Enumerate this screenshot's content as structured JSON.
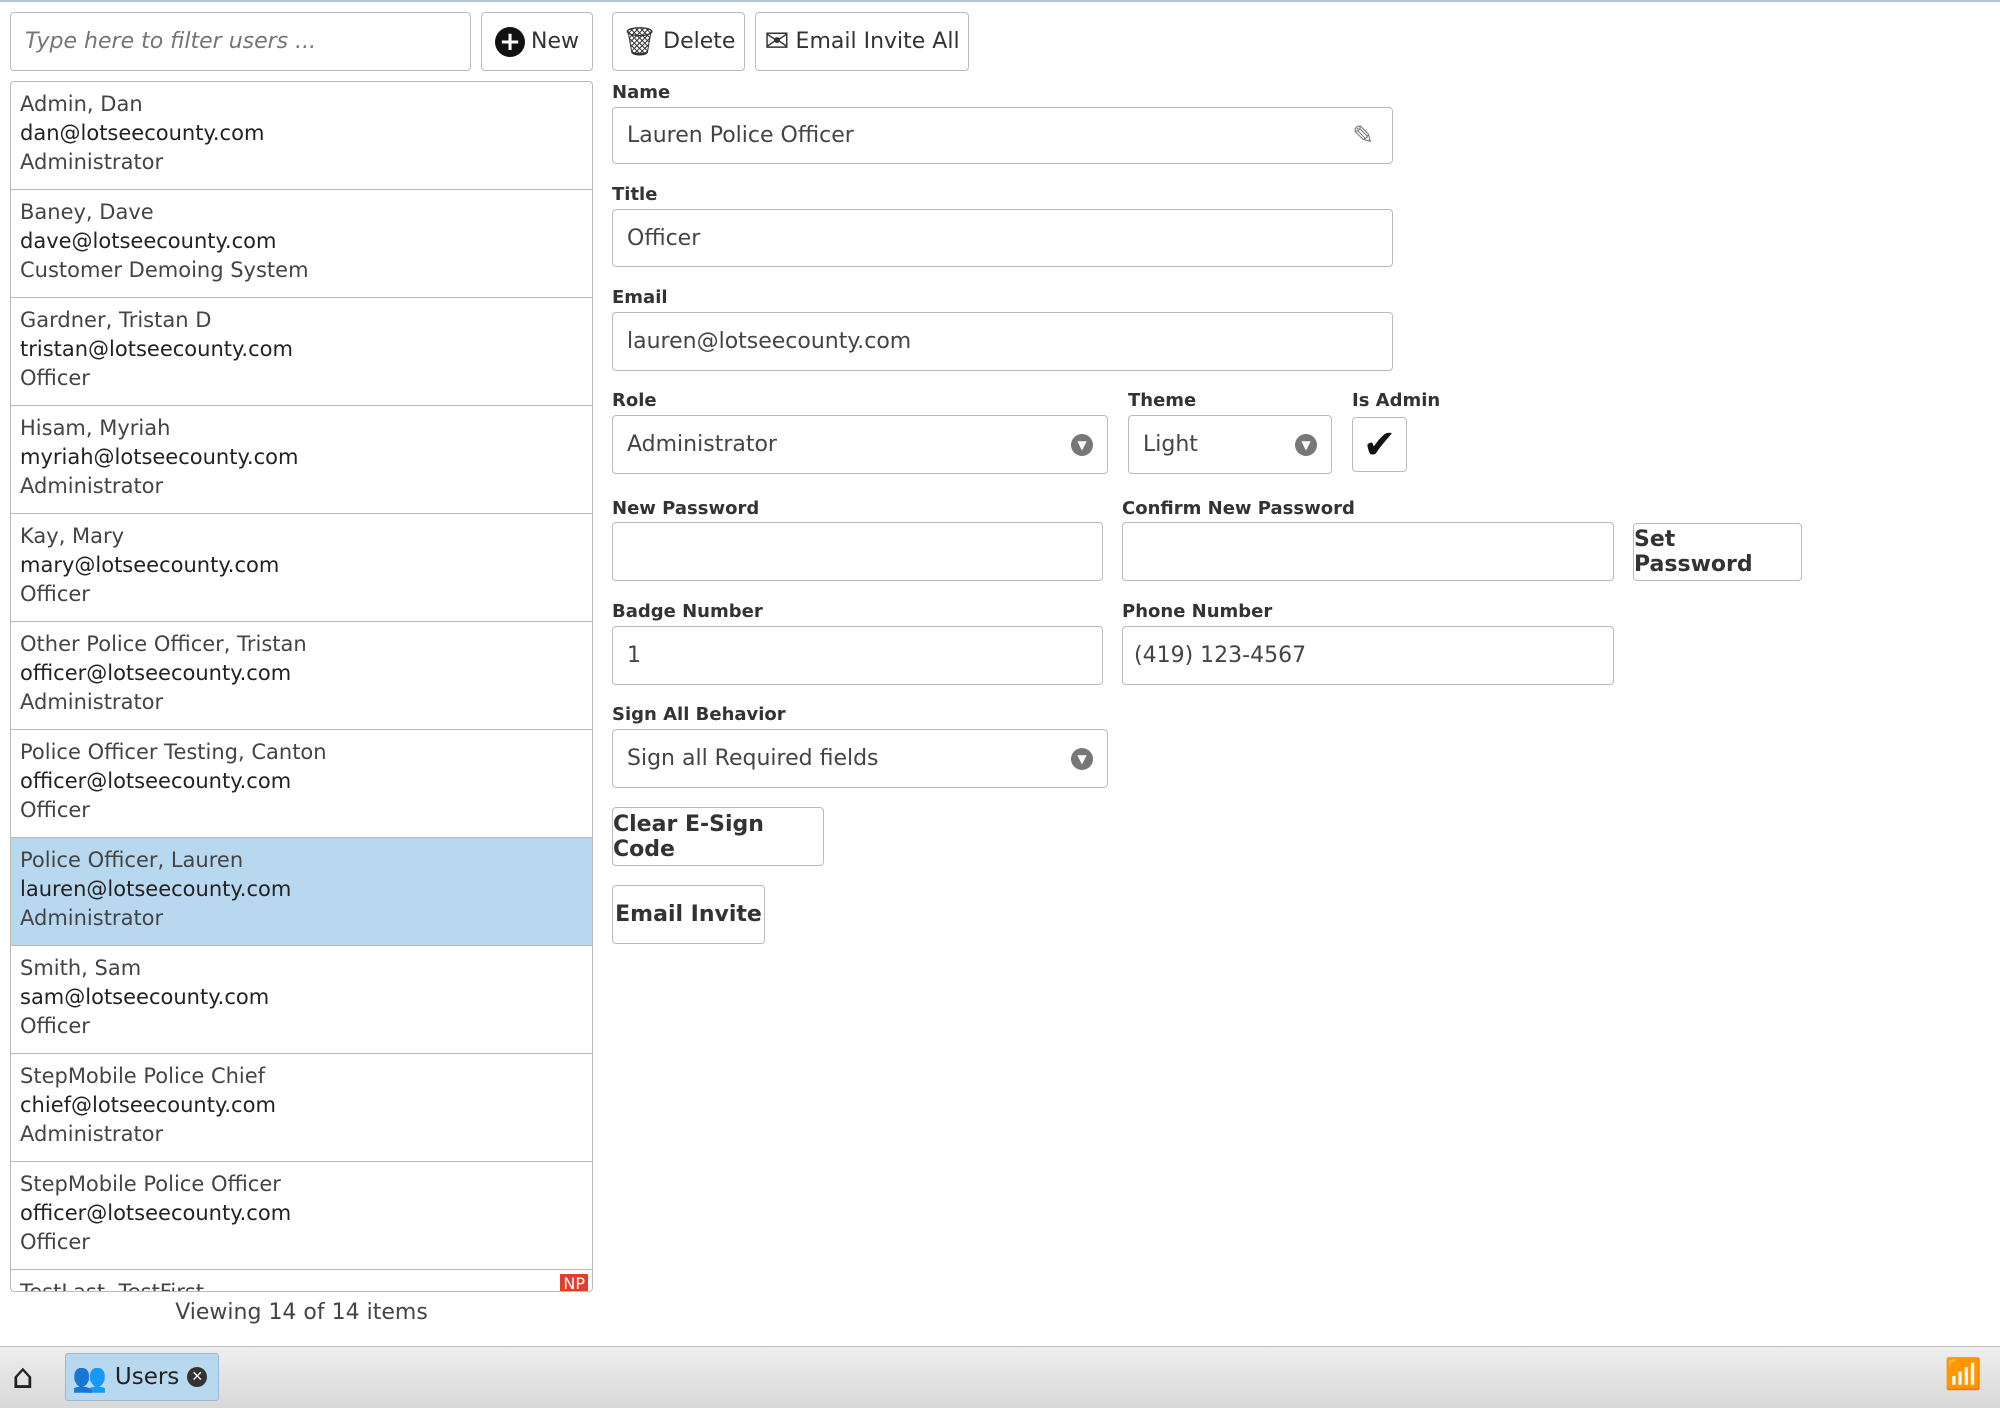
{
  "toolbar": {
    "filter_placeholder": "Type here to filter users ...",
    "new_label": "New",
    "delete_label": "Delete",
    "email_all_label": "Email Invite All"
  },
  "users": [
    {
      "name": "Admin, Dan",
      "email": "dan@lotseecounty.com",
      "role": "Administrator"
    },
    {
      "name": "Baney, Dave",
      "email": "dave@lotseecounty.com",
      "role": "Customer Demoing System"
    },
    {
      "name": "Gardner, Tristan D",
      "email": "tristan@lotseecounty.com",
      "role": "Officer"
    },
    {
      "name": "Hisam, Myriah",
      "email": "myriah@lotseecounty.com",
      "role": "Administrator"
    },
    {
      "name": "Kay, Mary",
      "email": "mary@lotseecounty.com",
      "role": "Officer"
    },
    {
      "name": "Other Police Officer, Tristan",
      "email": "officer@lotseecounty.com",
      "role": "Administrator"
    },
    {
      "name": "Police Officer Testing, Canton",
      "email": "officer@lotseecounty.com",
      "role": "Officer"
    },
    {
      "name": "Police Officer, Lauren",
      "email": "lauren@lotseecounty.com",
      "role": "Administrator",
      "selected": true
    },
    {
      "name": "Smith, Sam",
      "email": "sam@lotseecounty.com",
      "role": "Officer"
    },
    {
      "name": "StepMobile Police Chief",
      "email": "chief@lotseecounty.com",
      "role": "Administrator"
    },
    {
      "name": "StepMobile Police Officer",
      "email": "officer@lotseecounty.com",
      "role": "Officer"
    },
    {
      "name": "TestLast, TestFirst",
      "email": "",
      "role": "",
      "badge": "NP"
    }
  ],
  "list_footer": "Viewing 14 of 14 items",
  "form": {
    "name_label": "Name",
    "name": "Lauren Police Officer",
    "title_label": "Title",
    "title": "Officer",
    "email_label": "Email",
    "email": "lauren@lotseecounty.com",
    "role_label": "Role",
    "role": "Administrator",
    "theme_label": "Theme",
    "theme": "Light",
    "is_admin_label": "Is Admin",
    "is_admin": true,
    "new_password_label": "New Password",
    "new_password": "",
    "confirm_password_label": "Confirm New Password",
    "confirm_password": "",
    "set_password_label": "Set Password",
    "badge_label": "Badge Number",
    "badge": "1",
    "phone_label": "Phone Number",
    "phone": "(419) 123-4567",
    "sign_all_label": "Sign All Behavior",
    "sign_all": "Sign all Required fields",
    "clear_esign_label": "Clear E-Sign Code",
    "email_invite_label": "Email Invite"
  },
  "taskbar": {
    "tab_label": "Users"
  },
  "colors": {
    "selected": "#b8d8f0",
    "badge": "#e0402a",
    "wifi": "#3cc43c"
  }
}
